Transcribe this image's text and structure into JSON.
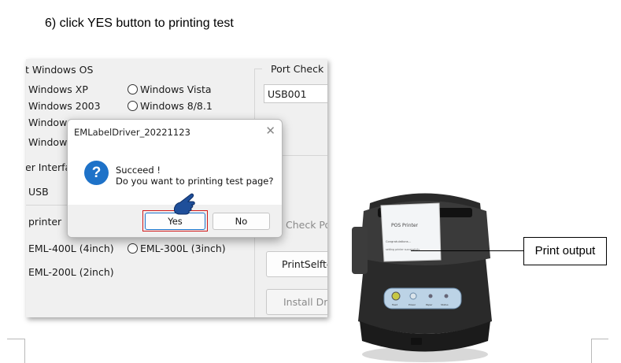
{
  "instruction": "6) click YES button to printing test",
  "settings": {
    "os_group_label": "t Windows OS",
    "os_options": [
      "Windows XP",
      "Windows Vista",
      "Windows 2003",
      "Windows 8/8.1",
      "Windows",
      "Windows"
    ],
    "port_check_label": "Port Check",
    "port_value": "USB001",
    "interface_label": "er Interfac",
    "interface_value": "USB",
    "printer_label": "printer",
    "printer_options": [
      "EML-400L (4inch)",
      "EML-300L (3inch)",
      "EML-200L (2inch)"
    ],
    "check_port_button": "Check Por",
    "print_selftest_button": "PrintSelfte",
    "install_driver_button": "Install Driv"
  },
  "dialog": {
    "title": "EMLabelDriver_20221123",
    "message_line1": "Succeed !",
    "message_line2": "Do you want to printing test page?",
    "yes_label": "Yes",
    "no_label": "No"
  },
  "photo": {
    "receipt_title": "POS Printer",
    "receipt_line1": "Congratulations...",
    "receipt_line2": "setting printer successfully",
    "leds": [
      "Feed",
      "Power",
      "Paper",
      "Status"
    ]
  },
  "callout": {
    "label": "Print output"
  },
  "colors": {
    "dialog_accent": "#1e72c8",
    "highlight": "#d11a1a",
    "hand": "#1f4f9a"
  }
}
